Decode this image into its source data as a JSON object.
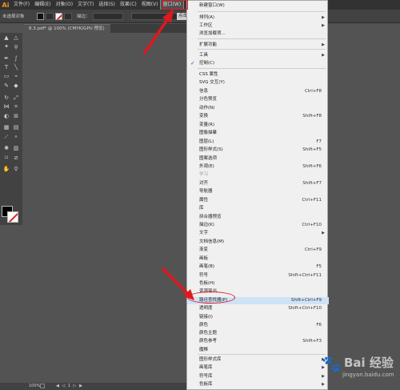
{
  "app": {
    "logo": "Ai"
  },
  "menubar": {
    "items": [
      "文件(F)",
      "编辑(E)",
      "对象(O)",
      "文字(T)",
      "选择(S)",
      "效果(C)",
      "视图(V)",
      "窗口(W)"
    ]
  },
  "controlbar": {
    "selection_label": "未选择对象",
    "stroke_label": "描边：",
    "button_fragment": "点击"
  },
  "document_tab": {
    "title": "8.3.pdf* @ 100% (CMYK/GPU 预览)"
  },
  "statusbar": {
    "zoom": "100%",
    "nav": "◀ ◁ 1 ▷ ▶"
  },
  "menu": {
    "items": [
      {
        "label": "新建窗口(W)",
        "shortcut": "",
        "arrow": "",
        "checked": false,
        "dim": false,
        "highlight": false
      },
      {
        "label": "排列(A)",
        "shortcut": "",
        "arrow": "▶",
        "checked": false,
        "dim": false,
        "highlight": false
      },
      {
        "label": "工作区",
        "shortcut": "",
        "arrow": "▶",
        "checked": false,
        "dim": false,
        "highlight": false
      },
      {
        "label": "浏览加载项...",
        "shortcut": "",
        "arrow": "",
        "checked": false,
        "dim": false,
        "highlight": false
      },
      {
        "label": "扩展功能",
        "shortcut": "",
        "arrow": "▶",
        "checked": false,
        "dim": false,
        "highlight": false
      },
      {
        "label": "工具",
        "shortcut": "",
        "arrow": "▶",
        "checked": false,
        "dim": false,
        "highlight": false
      },
      {
        "label": "控制(C)",
        "shortcut": "",
        "arrow": "",
        "checked": true,
        "dim": false,
        "highlight": false
      },
      {
        "label": "CSS 属性",
        "shortcut": "",
        "arrow": "",
        "checked": false,
        "dim": false,
        "highlight": false
      },
      {
        "label": "SVG 交互(Y)",
        "shortcut": "",
        "arrow": "",
        "checked": false,
        "dim": false,
        "highlight": false
      },
      {
        "label": "信息",
        "shortcut": "Ctrl+F8",
        "arrow": "",
        "checked": false,
        "dim": false,
        "highlight": false
      },
      {
        "label": "分色预览",
        "shortcut": "",
        "arrow": "",
        "checked": false,
        "dim": false,
        "highlight": false
      },
      {
        "label": "动作(N)",
        "shortcut": "",
        "arrow": "",
        "checked": false,
        "dim": false,
        "highlight": false
      },
      {
        "label": "变换",
        "shortcut": "Shift+F8",
        "arrow": "",
        "checked": false,
        "dim": false,
        "highlight": false
      },
      {
        "label": "变量(R)",
        "shortcut": "",
        "arrow": "",
        "checked": false,
        "dim": false,
        "highlight": false
      },
      {
        "label": "图像描摹",
        "shortcut": "",
        "arrow": "",
        "checked": false,
        "dim": false,
        "highlight": false
      },
      {
        "label": "图层(L)",
        "shortcut": "F7",
        "arrow": "",
        "checked": false,
        "dim": false,
        "highlight": false
      },
      {
        "label": "图形样式(S)",
        "shortcut": "Shift+F5",
        "arrow": "",
        "checked": false,
        "dim": false,
        "highlight": false
      },
      {
        "label": "图案选项",
        "shortcut": "",
        "arrow": "",
        "checked": false,
        "dim": false,
        "highlight": false
      },
      {
        "label": "外观(E)",
        "shortcut": "Shift+F6",
        "arrow": "",
        "checked": false,
        "dim": false,
        "highlight": false
      },
      {
        "label": "学习",
        "shortcut": "",
        "arrow": "",
        "checked": false,
        "dim": true,
        "highlight": false
      },
      {
        "label": "对齐",
        "shortcut": "Shift+F7",
        "arrow": "",
        "checked": false,
        "dim": false,
        "highlight": false
      },
      {
        "label": "导航器",
        "shortcut": "",
        "arrow": "",
        "checked": false,
        "dim": false,
        "highlight": false
      },
      {
        "label": "属性",
        "shortcut": "Ctrl+F11",
        "arrow": "",
        "checked": false,
        "dim": false,
        "highlight": false
      },
      {
        "label": "库",
        "shortcut": "",
        "arrow": "",
        "checked": false,
        "dim": false,
        "highlight": false
      },
      {
        "label": "拼合器预览",
        "shortcut": "",
        "arrow": "",
        "checked": false,
        "dim": false,
        "highlight": false
      },
      {
        "label": "描边(K)",
        "shortcut": "Ctrl+F10",
        "arrow": "",
        "checked": false,
        "dim": false,
        "highlight": false
      },
      {
        "label": "文字",
        "shortcut": "",
        "arrow": "▶",
        "checked": false,
        "dim": false,
        "highlight": false
      },
      {
        "label": "文档信息(M)",
        "shortcut": "",
        "arrow": "",
        "checked": false,
        "dim": false,
        "highlight": false
      },
      {
        "label": "渐变",
        "shortcut": "Ctrl+F9",
        "arrow": "",
        "checked": false,
        "dim": false,
        "highlight": false
      },
      {
        "label": "画板",
        "shortcut": "",
        "arrow": "",
        "checked": false,
        "dim": false,
        "highlight": false
      },
      {
        "label": "画笔(B)",
        "shortcut": "F5",
        "arrow": "",
        "checked": false,
        "dim": false,
        "highlight": false
      },
      {
        "label": "符号",
        "shortcut": "Shift+Ctrl+F11",
        "arrow": "",
        "checked": false,
        "dim": false,
        "highlight": false
      },
      {
        "label": "色板(H)",
        "shortcut": "",
        "arrow": "",
        "checked": false,
        "dim": false,
        "highlight": false
      },
      {
        "label": "资源导出",
        "shortcut": "",
        "arrow": "",
        "checked": false,
        "dim": false,
        "highlight": false
      },
      {
        "label": "路径查找器(P)",
        "shortcut": "Shift+Ctrl+F9",
        "arrow": "",
        "checked": false,
        "dim": false,
        "highlight": true
      },
      {
        "label": "透明度",
        "shortcut": "Shift+Ctrl+F10",
        "arrow": "",
        "checked": false,
        "dim": false,
        "highlight": false
      },
      {
        "label": "链接(I)",
        "shortcut": "",
        "arrow": "",
        "checked": false,
        "dim": false,
        "highlight": false
      },
      {
        "label": "颜色",
        "shortcut": "F6",
        "arrow": "",
        "checked": false,
        "dim": false,
        "highlight": false
      },
      {
        "label": "颜色主题",
        "shortcut": "",
        "arrow": "",
        "checked": false,
        "dim": false,
        "highlight": false
      },
      {
        "label": "颜色参考",
        "shortcut": "Shift+F3",
        "arrow": "",
        "checked": false,
        "dim": false,
        "highlight": false
      },
      {
        "label": "魔棒",
        "shortcut": "",
        "arrow": "",
        "checked": false,
        "dim": false,
        "highlight": false
      },
      {
        "label": "图形样式库",
        "shortcut": "",
        "arrow": "▶",
        "checked": false,
        "dim": false,
        "highlight": false
      },
      {
        "label": "画笔库",
        "shortcut": "",
        "arrow": "▶",
        "checked": false,
        "dim": false,
        "highlight": false
      },
      {
        "label": "符号库",
        "shortcut": "",
        "arrow": "▶",
        "checked": false,
        "dim": false,
        "highlight": false
      },
      {
        "label": "色板库",
        "shortcut": "",
        "arrow": "▶",
        "checked": false,
        "dim": false,
        "highlight": false
      }
    ]
  },
  "colors": {
    "accent_red": "#e0181f",
    "highlight_row": "#cfe3f7",
    "menu_bg": "#f0f0f0"
  },
  "watermark": {
    "brand": "Bai 经验",
    "url": "jingyan.baidu.com"
  }
}
